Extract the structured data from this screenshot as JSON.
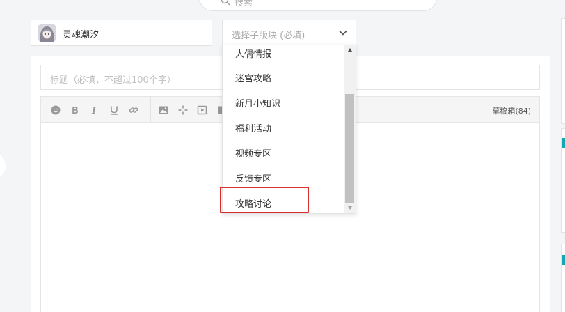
{
  "search": {
    "placeholder": "搜索"
  },
  "user": {
    "name": "灵魂潮汐"
  },
  "subforum_select": {
    "placeholder": "选择子版块 (必填)"
  },
  "title_input": {
    "placeholder": "标题（必填，不超过100个字）"
  },
  "toolbar": {
    "draft_label": "草稿箱(84)",
    "icons": [
      "emoji-icon",
      "bold-icon",
      "italic-icon",
      "underline-icon",
      "link-icon",
      "image-icon",
      "move-icon",
      "video-icon",
      "more-icon"
    ]
  },
  "dropdown": {
    "items": [
      {
        "label": "人偶情报"
      },
      {
        "label": "迷宫攻略"
      },
      {
        "label": "新月小知识"
      },
      {
        "label": "福利活动"
      },
      {
        "label": "视频专区"
      },
      {
        "label": "反馈专区"
      },
      {
        "label": "攻略讨论"
      }
    ],
    "highlighted": "攻略讨论"
  },
  "colors": {
    "accent_teal": "#12a8b3",
    "highlight_red": "#d9302b",
    "background": "#f4f5f7"
  }
}
